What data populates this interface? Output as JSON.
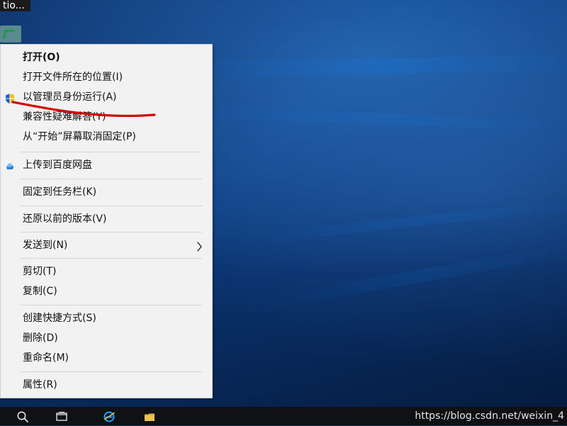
{
  "window": {
    "top_title_fragment": "tio..."
  },
  "context_menu": {
    "items": [
      {
        "label": "打开(O)",
        "bold": true
      },
      {
        "label": "打开文件所在的位置(I)"
      },
      {
        "label": "以管理员身份运行(A)",
        "icon": "uac-shield-icon"
      },
      {
        "label": "兼容性疑难解答(Y)"
      },
      {
        "label": "从“开始”屏幕取消固定(P)"
      },
      {
        "label": "上传到百度网盘",
        "icon": "baidu-netdisk-icon"
      },
      {
        "label": "固定到任务栏(K)"
      },
      {
        "label": "还原以前的版本(V)"
      },
      {
        "label": "发送到(N)",
        "submenu": true
      },
      {
        "label": "剪切(T)"
      },
      {
        "label": "复制(C)"
      },
      {
        "label": "创建快捷方式(S)"
      },
      {
        "label": "删除(D)"
      },
      {
        "label": "重命名(M)"
      },
      {
        "label": "属性(R)"
      }
    ]
  },
  "taskbar": {
    "watermark": "https://blog.csdn.net/weixin_4"
  },
  "colors": {
    "menu_bg": "#f2f2f2",
    "separator": "#d6d6d6",
    "annotation_red": "#d40000",
    "taskbar_bg": "#111111"
  }
}
